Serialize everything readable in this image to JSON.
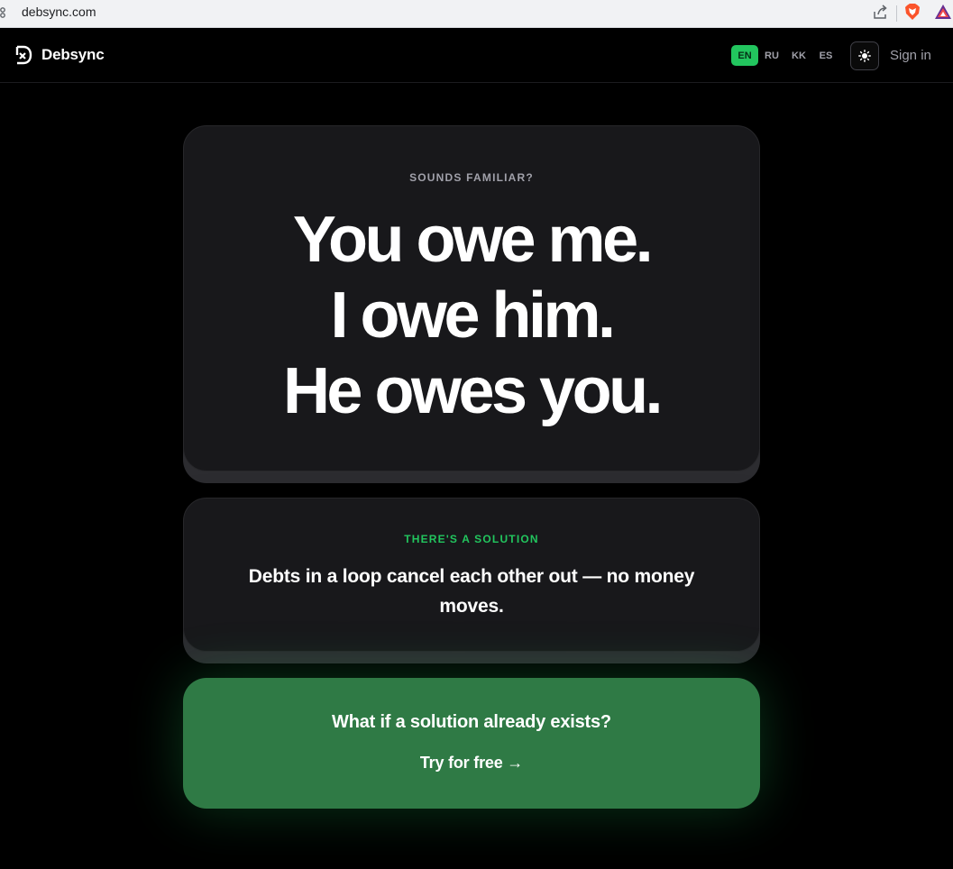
{
  "browser": {
    "url": "debsync.com"
  },
  "header": {
    "logo_text": "Debsync",
    "languages": [
      {
        "code": "EN",
        "active": true
      },
      {
        "code": "RU",
        "active": false
      },
      {
        "code": "KK",
        "active": false
      },
      {
        "code": "ES",
        "active": false
      }
    ],
    "theme_icon": "sun-icon",
    "sign_in_label": "Sign in"
  },
  "hero": {
    "eyebrow": "SOUNDS FAMILIAR?",
    "lines": [
      "You owe me.",
      "I owe him.",
      "He owes you."
    ]
  },
  "solution": {
    "eyebrow": "THERE'S A SOLUTION",
    "text": "Debts in a loop cancel each other out — no money moves."
  },
  "cta": {
    "question": "What if a solution already exists?",
    "button_label": "Try for free →"
  },
  "colors": {
    "accent": "#22c55e",
    "cta_background": "#2f7a45",
    "card_background": "#18181b",
    "page_background": "#000000"
  }
}
